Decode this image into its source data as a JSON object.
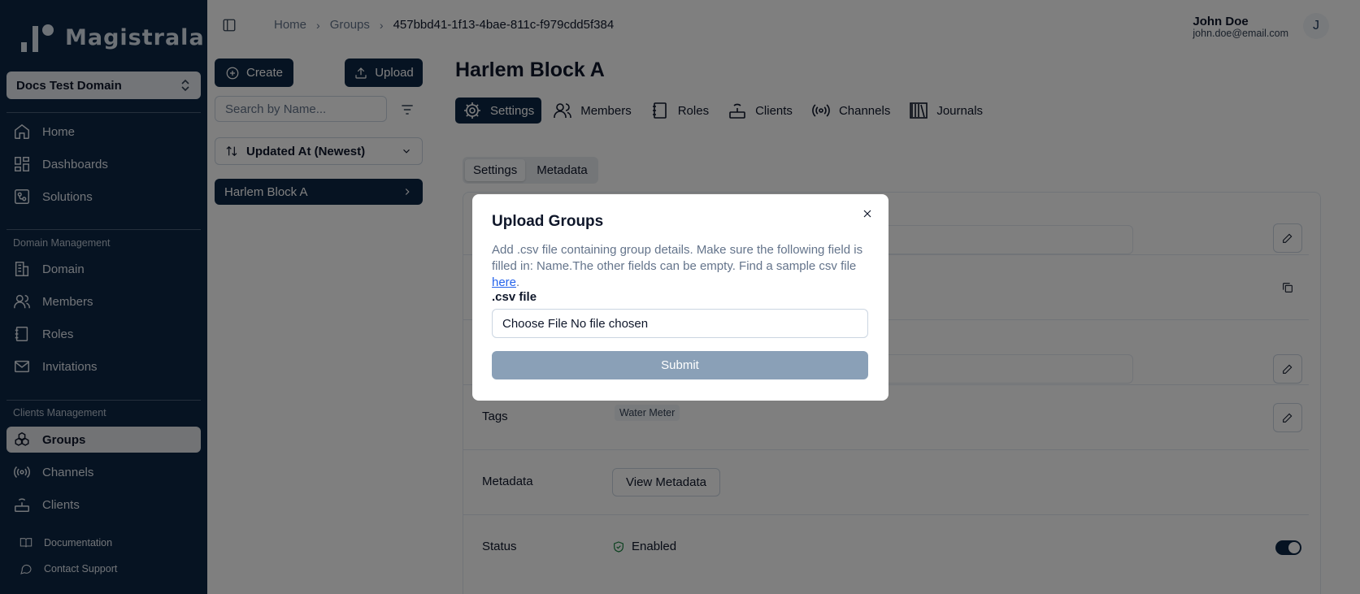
{
  "brand": {
    "name": "Magistrala"
  },
  "domain_selector": {
    "value": "Docs Test Domain"
  },
  "sidebar": {
    "main_items": [
      {
        "label": "Home",
        "icon": "home-icon"
      },
      {
        "label": "Dashboards",
        "icon": "dashboard-icon"
      },
      {
        "label": "Solutions",
        "icon": "solutions-icon"
      }
    ],
    "domain_section": "Domain Management",
    "domain_items": [
      {
        "label": "Domain",
        "icon": "building-icon"
      },
      {
        "label": "Members",
        "icon": "users-icon"
      },
      {
        "label": "Roles",
        "icon": "notebook-icon"
      },
      {
        "label": "Invitations",
        "icon": "mail-icon"
      }
    ],
    "clients_section": "Clients Management",
    "clients_items": [
      {
        "label": "Groups",
        "icon": "groups-icon",
        "active": true
      },
      {
        "label": "Channels",
        "icon": "broadcast-icon"
      },
      {
        "label": "Clients",
        "icon": "router-icon"
      }
    ],
    "footer_items": [
      {
        "label": "Documentation",
        "icon": "book-icon"
      },
      {
        "label": "Contact Support",
        "icon": "chat-icon"
      }
    ]
  },
  "breadcrumb": {
    "home": "Home",
    "groups": "Groups",
    "current": "457bbd41-1f13-4bae-811c-f979cdd5f384"
  },
  "user": {
    "name": "John Doe",
    "email": "john.doe@email.com",
    "initial": "J"
  },
  "left_panel": {
    "create_label": "Create",
    "upload_label": "Upload",
    "search_placeholder": "Search by Name...",
    "sort_value": "Updated At (Newest)",
    "groups": [
      "Harlem Block A"
    ]
  },
  "group": {
    "title": "Harlem Block A"
  },
  "tabs": [
    "Settings",
    "Members",
    "Roles",
    "Clients",
    "Channels",
    "Journals"
  ],
  "subtabs": [
    "Settings",
    "Metadata"
  ],
  "details": {
    "tags_label": "Tags",
    "tag_value": "Water Meter",
    "metadata_label": "Metadata",
    "view_metadata_label": "View Metadata",
    "status_label": "Status",
    "status_value": "Enabled"
  },
  "modal": {
    "title": "Upload Groups",
    "description": "Add .csv file containing group details. Make sure the following field is filled in: Name.The other fields can be empty. Find a sample csv file ",
    "link_text": "here",
    "after_link": ".",
    "file_label": ".csv file",
    "choose_file": "Choose File",
    "no_file": "No file chosen",
    "submit_label": "Submit"
  },
  "colors": {
    "primary": "#0d2644",
    "submit_disabled": "#8aa0b7",
    "link": "#2563eb"
  }
}
